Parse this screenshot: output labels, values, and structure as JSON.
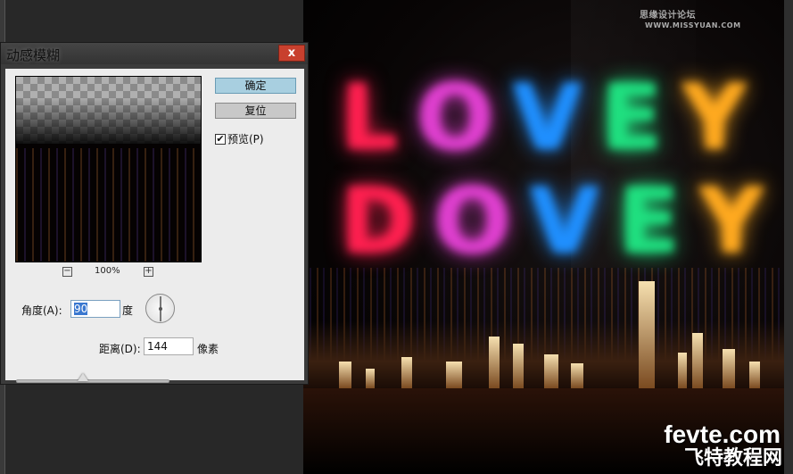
{
  "watermark_top": {
    "cn": "思缘设计论坛",
    "url": "WWW.MISSYUAN.COM"
  },
  "artwork": {
    "line1": [
      "L",
      "O",
      "V",
      "E",
      "Y"
    ],
    "line2": [
      "D",
      "O",
      "V",
      "E",
      "Y"
    ]
  },
  "watermark_bottom": {
    "url": "fevte.com",
    "cn": "飞特教程网"
  },
  "dialog": {
    "title": "动感模糊",
    "close_label": "x",
    "ok_label": "确定",
    "reset_label": "复位",
    "preview_label": "预览(P)",
    "preview_checked": true,
    "zoom_out": "−",
    "zoom_in": "+",
    "zoom_level": "100%",
    "angle_label": "角度(A):",
    "angle_value": "90",
    "angle_unit": "度",
    "distance_label": "距离(D):",
    "distance_value": "144",
    "distance_unit": "像素"
  },
  "colors": {
    "ok_button": "#a8cfe0",
    "close_button": "#c8402e"
  }
}
